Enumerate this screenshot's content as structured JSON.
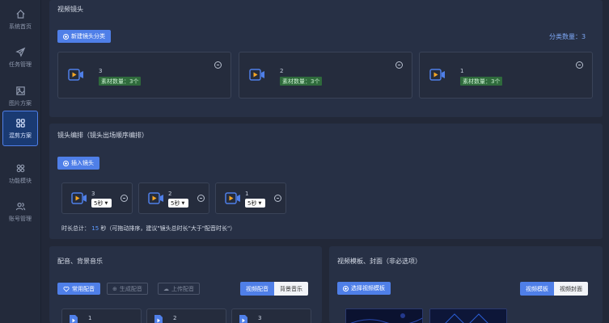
{
  "sidebar": {
    "items": [
      {
        "label": "系统首页",
        "icon": "home-icon"
      },
      {
        "label": "任务管理",
        "icon": "send-icon"
      },
      {
        "label": "图片方案",
        "icon": "image-icon"
      },
      {
        "label": "混剪方案",
        "icon": "grid-icon",
        "active": true
      },
      {
        "label": "功能模块",
        "icon": "modules-icon"
      },
      {
        "label": "账号管理",
        "icon": "users-icon"
      }
    ]
  },
  "video_shots": {
    "title": "视频镜头",
    "new_button": "新建镜头分类",
    "count_label": "分类数量：",
    "count_value": "3",
    "cards": [
      {
        "num": "3",
        "badge": "素材数量：3个"
      },
      {
        "num": "2",
        "badge": "素材数量：3个"
      },
      {
        "num": "1",
        "badge": "素材数量：3个"
      }
    ]
  },
  "shot_order": {
    "title": "镜头编排（镜头出场顺序编排）",
    "insert_button": "插入镜头",
    "items": [
      {
        "num": "3",
        "duration": "5秒"
      },
      {
        "num": "2",
        "duration": "5秒"
      },
      {
        "num": "1",
        "duration": "5秒"
      }
    ],
    "total_prefix": "时长总计：",
    "total_value": "15",
    "total_suffix": "秒（可拖动排序，建议\"镜头总时长\"大于\"配音时长\"）"
  },
  "audio": {
    "title": "配音、背景音乐",
    "common_button": "常用配音",
    "generate_button": "生成配音",
    "upload_button": "上传配音",
    "tabs": [
      "视频配音",
      "背景音乐"
    ],
    "cards": [
      "1",
      "2",
      "3"
    ]
  },
  "template": {
    "title": "视频模板、封面（非必选项）",
    "select_button": "选择视频模板",
    "tabs": [
      "视频模板",
      "视频封面"
    ]
  },
  "colors": {
    "accent": "#4f7fe8",
    "background": "#222838",
    "panel": "#273045",
    "badge": "#2f6b3c",
    "camera_orange": "#f5a623"
  }
}
